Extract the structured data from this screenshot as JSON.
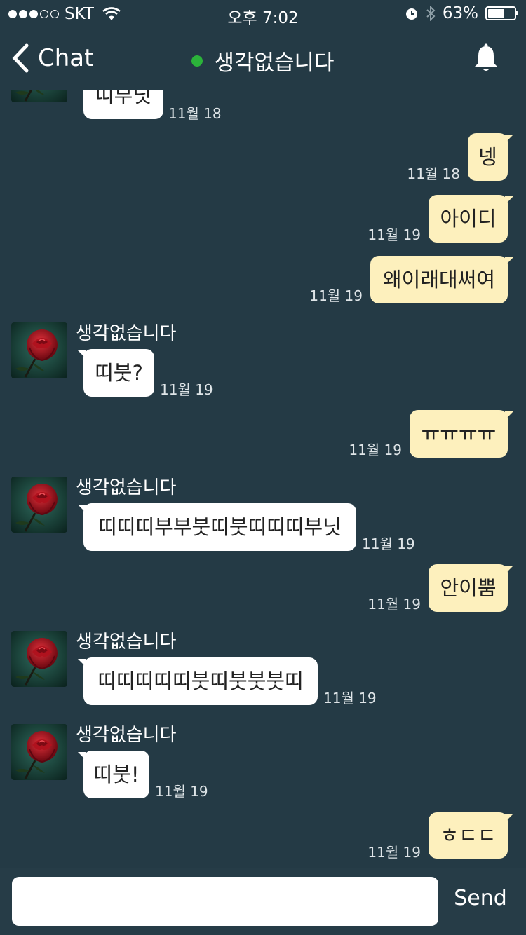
{
  "status": {
    "carrier": "SKT",
    "time": "오후 7:02",
    "battery": "63%",
    "battery_level": 0.63,
    "signal_bars": 3
  },
  "nav": {
    "back_label": "Chat",
    "title": "생각없습니다",
    "online_color": "#2bb33a"
  },
  "messages": [
    {
      "sender": "",
      "text": "띠부닛",
      "time": "11월 18"
    },
    {
      "text": "넹",
      "time": "11월 18"
    },
    {
      "text": "아이디",
      "time": "11월 19"
    },
    {
      "text": "왜이래대써여",
      "time": "11월 19"
    },
    {
      "sender": "생각없습니다",
      "text": "띠붓?",
      "time": "11월 19"
    },
    {
      "text": "ㅠㅠㅠㅠ",
      "time": "11월 19"
    },
    {
      "sender": "생각없습니다",
      "text": "띠띠띠부부붓띠붓띠띠띠부닛",
      "time": "11월 19"
    },
    {
      "text": "안이뿜",
      "time": "11월 19"
    },
    {
      "sender": "생각없습니다",
      "text": "띠띠띠띠띠붓띠붓붓붓띠",
      "time": "11월 19"
    },
    {
      "sender": "생각없습니다",
      "text": "띠붓!",
      "time": "11월 19"
    },
    {
      "text": "ㅎㄷㄷ",
      "time": "11월 19"
    }
  ],
  "input": {
    "placeholder": "",
    "send_label": "Send"
  },
  "colors": {
    "background": "#243a45",
    "incoming_bubble": "#ffffff",
    "outgoing_bubble": "#fdf0bd"
  }
}
